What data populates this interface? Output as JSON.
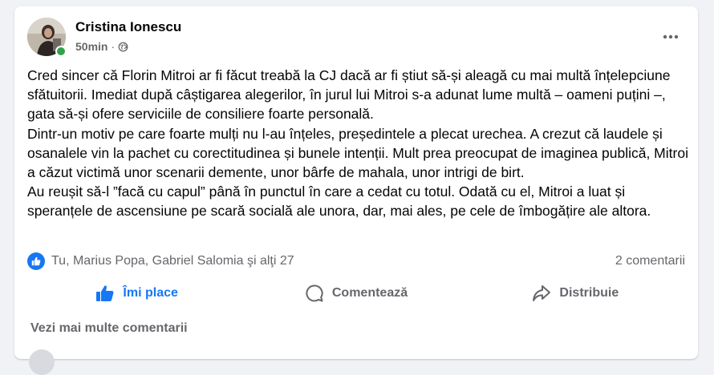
{
  "post": {
    "author": "Cristina Ionescu",
    "time": "50min",
    "separator": "·",
    "privacy_icon": "globe-icon",
    "paragraphs": [
      "Cred sincer că Florin Mitroi ar fi făcut treabă la CJ dacă ar fi știut să-și aleagă cu mai multă înțelepciune sfătuitorii. Imediat după câștigarea alegerilor, în jurul lui Mitroi s-a adunat lume multă – oameni puțini –, gata să-și ofere serviciile de consiliere foarte personală.",
      "Dintr-un motiv pe care foarte mulți nu l-au înțeles, președintele a plecat urechea. A crezut că laudele și osanalele vin la pachet cu corectitudinea și bunele intenții. Mult prea preocupat de imaginea publică, Mitroi a căzut victimă unor scenarii demente, unor bârfe de mahala, unor intrigi de birt.",
      "Au reușit să-l ”facă cu capul” până în punctul în care a cedat cu totul. Odată cu el, Mitroi a luat și speranțele de ascensiune pe scară socială ale unora, dar, mai ales, pe cele de îmbogățire ale altora."
    ]
  },
  "stats": {
    "reactions_text": "Tu, Marius Popa, Gabriel Salomia şi alţi 27",
    "comments_count": "2 comentarii"
  },
  "actions": {
    "like_label": "Îmi place",
    "comment_label": "Comentează",
    "share_label": "Distribuie"
  },
  "comments": {
    "more_label": "Vezi mai multe comentarii"
  },
  "colors": {
    "accent": "#1877f2",
    "secondary_text": "#65676b",
    "online": "#31a24c"
  }
}
